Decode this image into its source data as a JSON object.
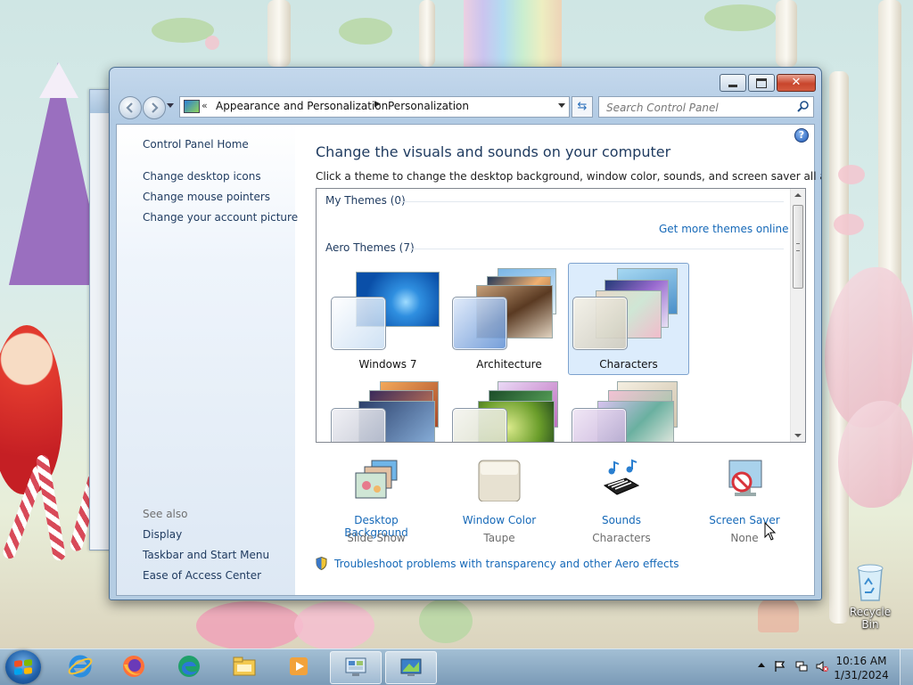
{
  "window": {
    "address": {
      "chevron": "«",
      "crumb1": "Appearance and Personalization",
      "crumb2": "Personalization"
    },
    "search_placeholder": "Search Control Panel"
  },
  "left_pane": {
    "links": [
      "Control Panel Home",
      "Change desktop icons",
      "Change mouse pointers",
      "Change your account picture"
    ],
    "see_also_label": "See also",
    "see_also": [
      "Display",
      "Taskbar and Start Menu",
      "Ease of Access Center"
    ]
  },
  "main": {
    "title": "Change the visuals and sounds on your computer",
    "subtitle": "Click a theme to change the desktop background, window color, sounds, and screen saver all at once.",
    "my_themes_label": "My Themes (0)",
    "get_more_link": "Get more themes online",
    "aero_themes_label": "Aero Themes (7)",
    "themes": [
      {
        "name": "Windows 7",
        "selected": false
      },
      {
        "name": "Architecture",
        "selected": false
      },
      {
        "name": "Characters",
        "selected": true
      }
    ],
    "quick_settings": [
      {
        "name": "Desktop Background",
        "value": "Slide Show",
        "icon": "desktop-background-icon"
      },
      {
        "name": "Window Color",
        "value": "Taupe",
        "icon": "window-color-icon"
      },
      {
        "name": "Sounds",
        "value": "Characters",
        "icon": "sounds-icon"
      },
      {
        "name": "Screen Saver",
        "value": "None",
        "icon": "screen-saver-icon"
      }
    ],
    "troubleshoot_link": "Troubleshoot problems with transparency and other Aero effects"
  },
  "desktop": {
    "recycle_bin_label": "Recycle Bin"
  },
  "taskbar": {
    "apps": [
      "internet-explorer-icon",
      "firefox-icon",
      "edge-icon",
      "file-explorer-icon",
      "media-player-icon",
      "control-panel-icon",
      "personalization-icon"
    ],
    "time": "10:16 AM",
    "date": "1/31/2024"
  },
  "colors": {
    "window_frame": "#b2cbe4",
    "link": "#1669b8",
    "selected_tile": "#dcecfc",
    "title": "#1e3a5f"
  }
}
